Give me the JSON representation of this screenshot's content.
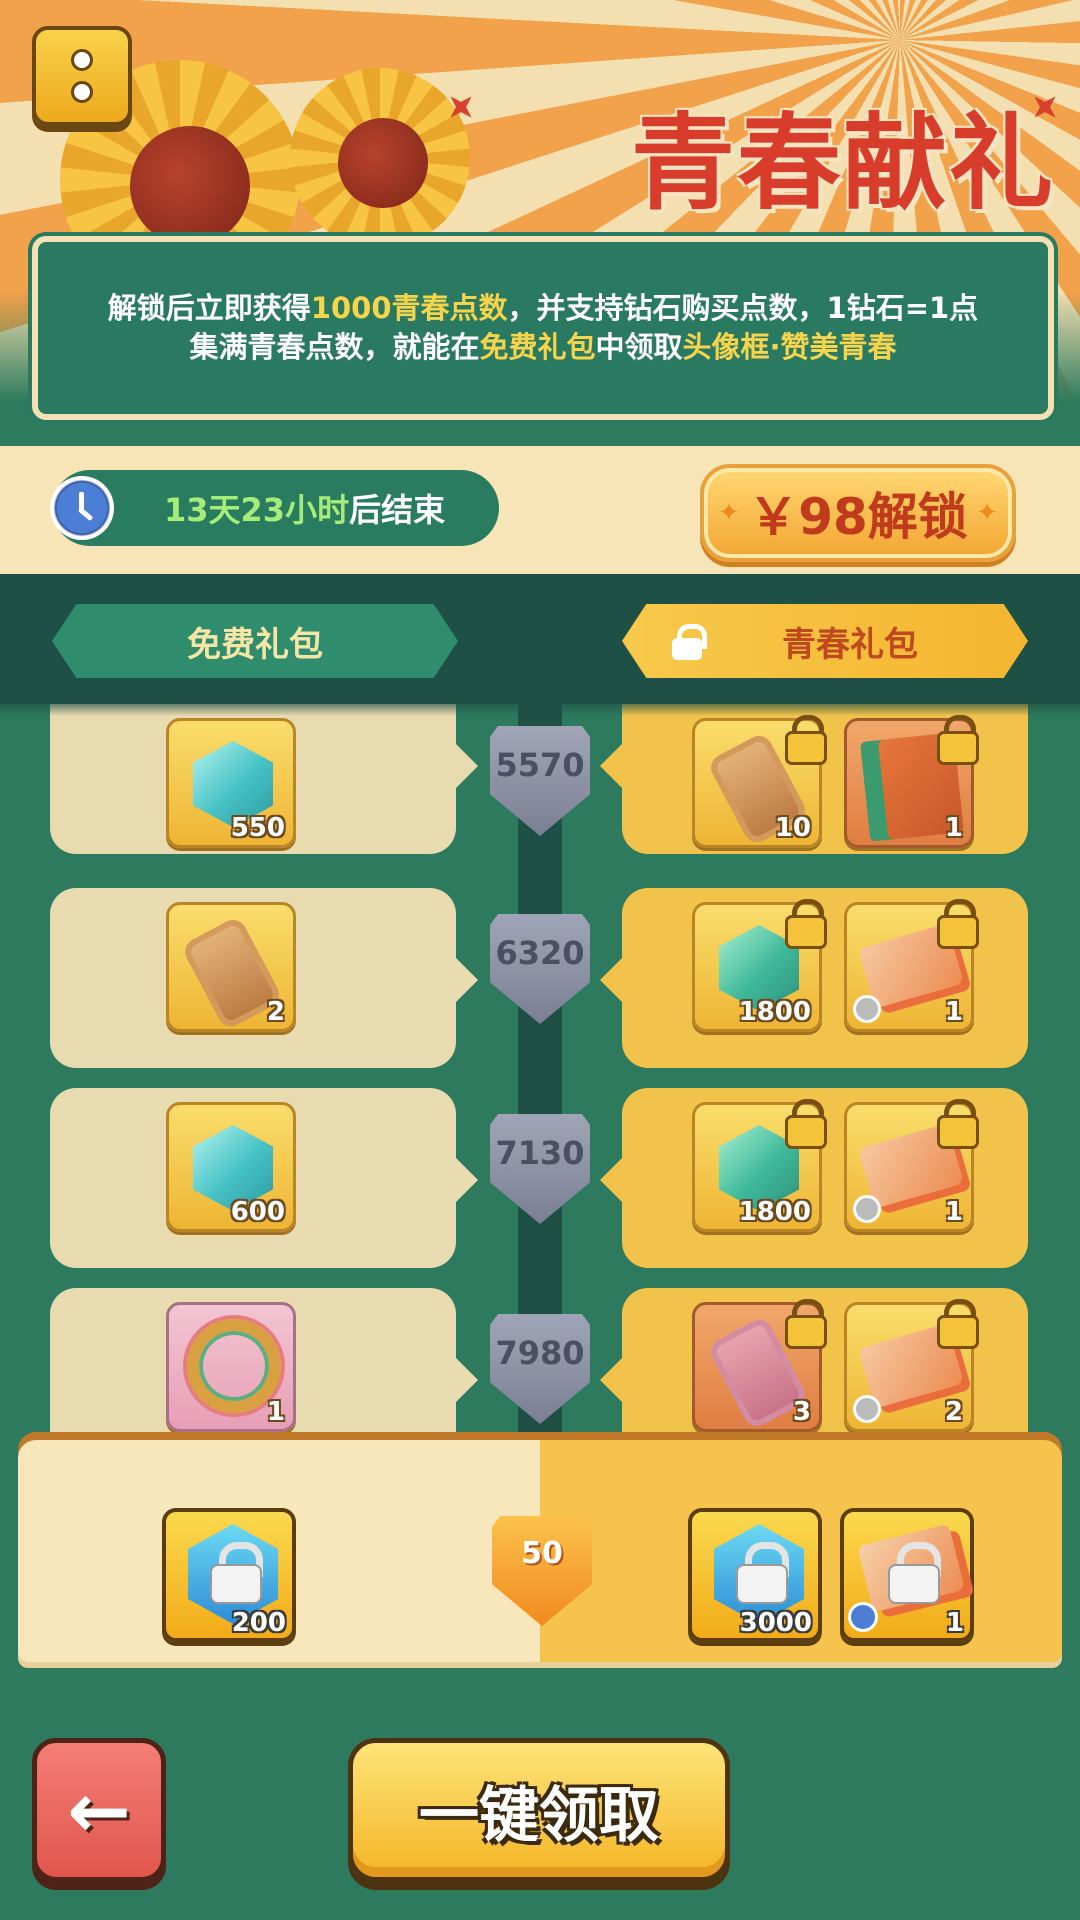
{
  "header": {
    "title": "青春献礼"
  },
  "info": {
    "line1_a": "解锁后立即获得",
    "line1_hl": "1000青春点数",
    "line1_b": "，并支持钻石购买点数，1钻石=1点",
    "line2_a": "集满青春点数，就能在",
    "line2_hl1": "免费礼包",
    "line2_b": "中领取",
    "line2_hl2": "头像框·赞美青春"
  },
  "timer": {
    "days_hours": "13天23小时",
    "suffix": "后结束"
  },
  "unlock_button": {
    "label": "￥98解锁"
  },
  "tabs": {
    "free": "免费礼包",
    "youth": "青春礼包"
  },
  "rows": [
    {
      "level": "5570",
      "free": {
        "icon": "gem-icon",
        "qty": "550"
      },
      "paid": [
        {
          "icon": "scroll-icon",
          "qty": "10"
        },
        {
          "icon": "book-icon",
          "qty": "1"
        }
      ]
    },
    {
      "level": "6320",
      "free": {
        "icon": "scroll-icon",
        "qty": "2"
      },
      "paid": [
        {
          "icon": "gem-icon",
          "qty": "1800"
        },
        {
          "icon": "ticket-icon",
          "qty": "1"
        }
      ]
    },
    {
      "level": "7130",
      "free": {
        "icon": "gem-icon",
        "qty": "600"
      },
      "paid": [
        {
          "icon": "gem-icon",
          "qty": "1800"
        },
        {
          "icon": "ticket-icon",
          "qty": "1"
        }
      ]
    },
    {
      "level": "7980",
      "free": {
        "icon": "ring-frame-icon",
        "qty": "1"
      },
      "paid": [
        {
          "icon": "scroll-icon",
          "qty": "3"
        },
        {
          "icon": "ticket-icon",
          "qty": "2"
        }
      ]
    }
  ],
  "claim_bar": {
    "level": "50",
    "free": {
      "icon": "hex-gem-icon",
      "qty": "200"
    },
    "paid": [
      {
        "icon": "hex-gem-icon",
        "qty": "3000"
      },
      {
        "icon": "ticket-icon",
        "qty": "1"
      }
    ]
  },
  "footer": {
    "back_icon": "←",
    "claim_all_label": "一键领取"
  },
  "colors": {
    "accent": "#f6c34c",
    "title_red": "#d83c2a",
    "panel_green": "#2a7a62"
  }
}
